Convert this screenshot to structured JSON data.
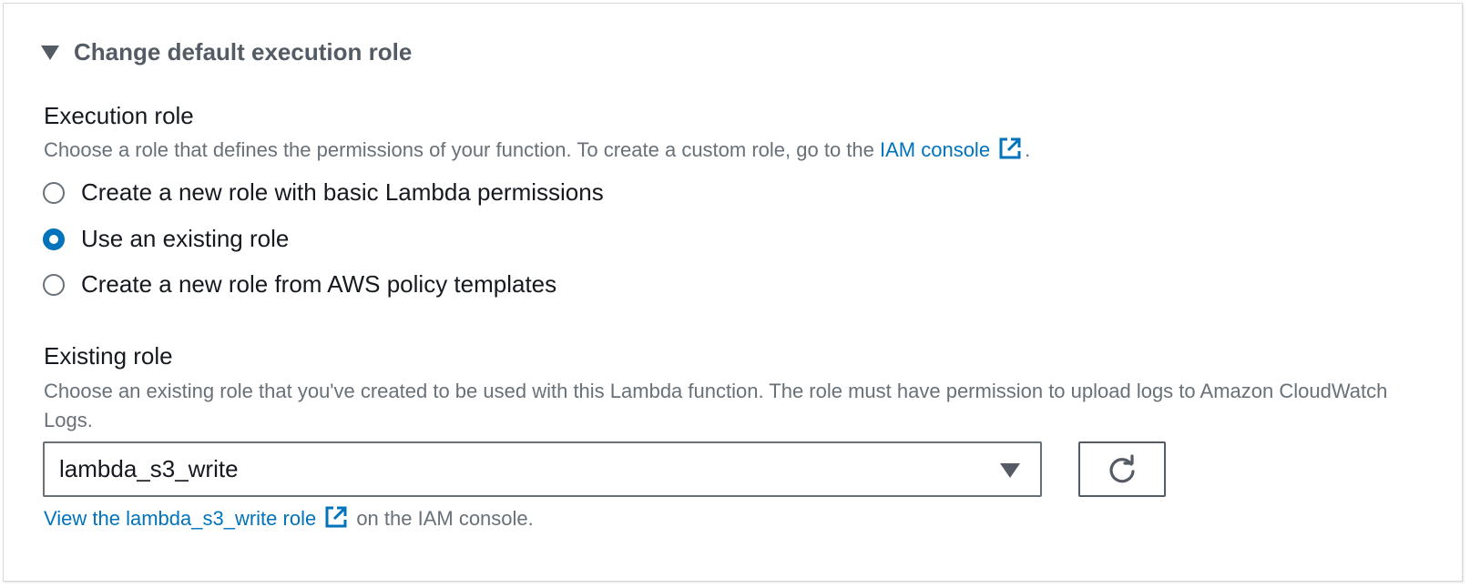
{
  "section": {
    "toggle_label": "Change default execution role",
    "expanded": true
  },
  "execution_role": {
    "label": "Execution role",
    "description_prefix": "Choose a role that defines the permissions of your function. To create a custom role, go to the ",
    "iam_link": "IAM console",
    "description_suffix": ".",
    "options": [
      {
        "label": "Create a new role with basic Lambda permissions",
        "selected": false
      },
      {
        "label": "Use an existing role",
        "selected": true
      },
      {
        "label": "Create a new role from AWS policy templates",
        "selected": false
      }
    ]
  },
  "existing_role": {
    "label": "Existing role",
    "description": "Choose an existing role that you've created to be used with this Lambda function. The role must have permission to upload logs to Amazon CloudWatch Logs.",
    "selected_value": "lambda_s3_write",
    "view_link": "View the lambda_s3_write role",
    "view_suffix": " on the IAM console."
  },
  "colors": {
    "link": "#0073bb",
    "secondary_text": "#687078",
    "primary_text": "#16191f"
  },
  "icons": [
    "caret-down-icon",
    "external-link-icon",
    "dropdown-caret-icon",
    "refresh-icon"
  ]
}
